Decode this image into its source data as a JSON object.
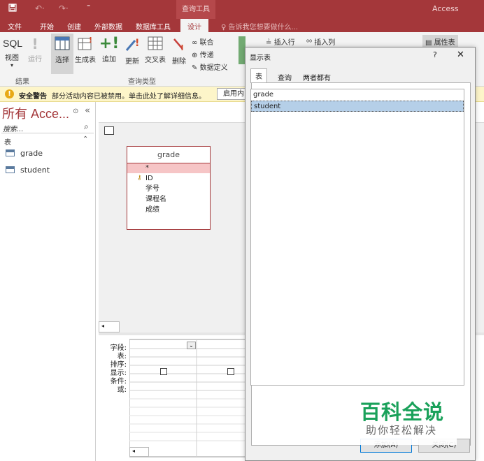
{
  "titlebar": {
    "quick_access": [
      "save-icon",
      "undo-icon",
      "redo-icon",
      "customize-icon"
    ],
    "context_tab": "查询工具",
    "app_name": "Access"
  },
  "menu": {
    "tabs": [
      "文件",
      "开始",
      "创建",
      "外部数据",
      "数据库工具",
      "设计"
    ],
    "active": "设计",
    "tell_me": "告诉我您想要做什么..."
  },
  "ribbon": {
    "sql": "SQL",
    "view": "视图",
    "run": "运行",
    "results_group": "结果",
    "select": "选择",
    "make_table": "生成表",
    "append": "追加",
    "update": "更新",
    "crosstab": "交叉表",
    "delete": "删除",
    "union": "联合",
    "pass_through": "传递",
    "data_definition": "数据定义",
    "query_type_group": "查询类型",
    "insert_row": "插入行",
    "insert_col": "插入列",
    "property_sheet": "属性表"
  },
  "security": {
    "label": "安全警告",
    "message": "部分活动内容已被禁用。单击此处了解详细信息。",
    "button": "启用内"
  },
  "nav": {
    "title": "所有 Acce...",
    "search_placeholder": "搜索...",
    "section": "表",
    "items": [
      "grade",
      "student"
    ]
  },
  "design": {
    "table_name": "grade",
    "star": "*",
    "fields": [
      "ID",
      "学号",
      "课程名",
      "成绩"
    ],
    "grid_labels": [
      "字段:",
      "表:",
      "排序:",
      "显示:",
      "条件:",
      "或:"
    ]
  },
  "dialog": {
    "title": "显示表",
    "help": "?",
    "tabs": [
      "表",
      "查询",
      "两者都有"
    ],
    "active_tab": "表",
    "list": [
      "grade",
      "student"
    ],
    "selected": "student",
    "add_button": "添加(A)",
    "close_button": "关闭(C)"
  },
  "watermark": {
    "title": "百科全说",
    "subtitle": "助你轻松解决"
  },
  "colors": {
    "brand": "#a4373a",
    "selection": "#b5cfe8",
    "warning_bar": "#fdf5c9",
    "watermark_green": "#1aa15a"
  }
}
